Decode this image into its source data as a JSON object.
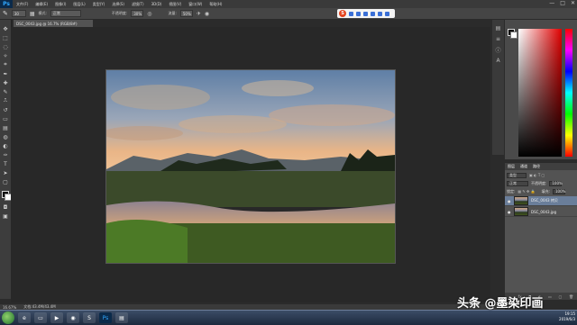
{
  "app": {
    "logo": "Ps"
  },
  "menu": [
    "文件(F)",
    "编辑(E)",
    "图像(I)",
    "图层(L)",
    "类型(Y)",
    "选择(S)",
    "滤镜(T)",
    "3D(D)",
    "视图(V)",
    "窗口(W)",
    "帮助(H)"
  ],
  "window_controls": {
    "minimize": "—",
    "maximize": "□",
    "close": "✕"
  },
  "options": {
    "size": "30",
    "mode_label": "模式:",
    "mode_value": "正常",
    "opacity_label": "不透明度:",
    "opacity_value": "30%",
    "flow_label": "流量:",
    "flow_value": "50%"
  },
  "document": {
    "tab_title": "DSC_0043.jpg @ 16.7% (RGB/8#)",
    "zoom": "16.67%",
    "doc_info": "文档:43.4M/43.4M"
  },
  "layers": {
    "tabs": [
      "图层",
      "通道",
      "路径"
    ],
    "kind_label": "类型",
    "blend_mode": "正常",
    "opacity_label": "不透明度:",
    "opacity_value": "100%",
    "lock_label": "锁定:",
    "fill_label": "填充:",
    "fill_value": "100%",
    "items": [
      {
        "name": "DSC_0043 拷贝",
        "selected": true
      },
      {
        "name": "DSC_0043.jpg",
        "selected": false
      }
    ],
    "bottom_icons": [
      "link-icon",
      "fx-icon",
      "mask-icon",
      "adjustment-icon",
      "folder-icon",
      "new-layer-icon",
      "trash-icon"
    ]
  },
  "taskbar": {
    "apps": [
      "ie-icon",
      "folder-icon",
      "media-icon",
      "chrome-icon",
      "sogou-icon",
      "photoshop-icon",
      "doc-icon"
    ],
    "time": "19:15",
    "date": "2019/6/3"
  },
  "watermark": "头条 @墨染印画",
  "colors": {
    "accent": "#31a8ff",
    "selected_layer": "#6a7e9a"
  }
}
